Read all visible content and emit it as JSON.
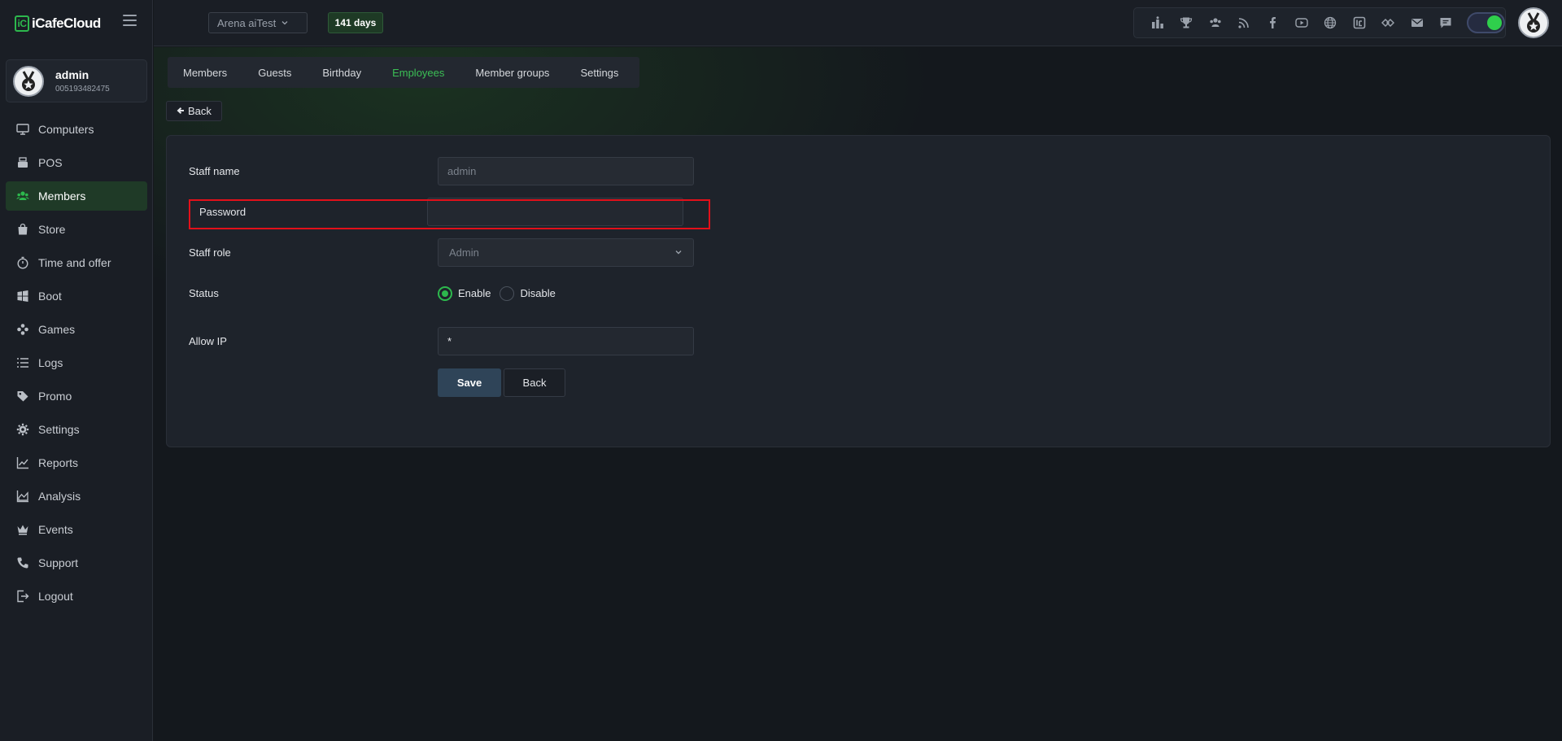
{
  "app": {
    "brand": "iCafeCloud",
    "brand_mark": "iC",
    "accent_color": "#2db84d"
  },
  "user": {
    "name": "admin",
    "id": "005193482475"
  },
  "topbar": {
    "shop": "Arena aiTest",
    "days": "141 days",
    "icons": [
      "ranking-icon",
      "trophy-icon",
      "users-icon",
      "rss-icon",
      "facebook-icon",
      "youtube-icon",
      "globe-icon",
      "icafe-icon",
      "plugin-icon",
      "mail-icon",
      "chat-icon"
    ],
    "theme_toggle_on": true
  },
  "sidebar": {
    "items": [
      {
        "label": "Computers",
        "icon": "monitor-icon",
        "active": false
      },
      {
        "label": "POS",
        "icon": "pos-icon",
        "active": false
      },
      {
        "label": "Members",
        "icon": "members-icon",
        "active": true
      },
      {
        "label": "Store",
        "icon": "bag-icon",
        "active": false
      },
      {
        "label": "Time and offer",
        "icon": "stopwatch-icon",
        "active": false
      },
      {
        "label": "Boot",
        "icon": "windows-icon",
        "active": false
      },
      {
        "label": "Games",
        "icon": "gamepad-icon",
        "active": false
      },
      {
        "label": "Logs",
        "icon": "list-icon",
        "active": false
      },
      {
        "label": "Promo",
        "icon": "tag-icon",
        "active": false
      },
      {
        "label": "Settings",
        "icon": "gear-icon",
        "active": false
      },
      {
        "label": "Reports",
        "icon": "line-chart-icon",
        "active": false
      },
      {
        "label": "Analysis",
        "icon": "area-chart-icon",
        "active": false
      },
      {
        "label": "Events",
        "icon": "crown-icon",
        "active": false
      },
      {
        "label": "Support",
        "icon": "phone-icon",
        "active": false
      },
      {
        "label": "Logout",
        "icon": "logout-icon",
        "active": false
      }
    ]
  },
  "tabs": [
    {
      "label": "Members",
      "active": false
    },
    {
      "label": "Guests",
      "active": false
    },
    {
      "label": "Birthday",
      "active": false
    },
    {
      "label": "Employees",
      "active": true
    },
    {
      "label": "Member groups",
      "active": false
    },
    {
      "label": "Settings",
      "active": false
    }
  ],
  "back_button": "Back",
  "form": {
    "staff_name_label": "Staff name",
    "staff_name_value": "admin",
    "password_label": "Password",
    "password_value": "",
    "staff_role_label": "Staff role",
    "staff_role_value": "Admin",
    "status_label": "Status",
    "status_enable": "Enable",
    "status_disable": "Disable",
    "status_selected": "Enable",
    "allow_ip_label": "Allow IP",
    "allow_ip_value": "*",
    "save_label": "Save",
    "back_label": "Back"
  }
}
